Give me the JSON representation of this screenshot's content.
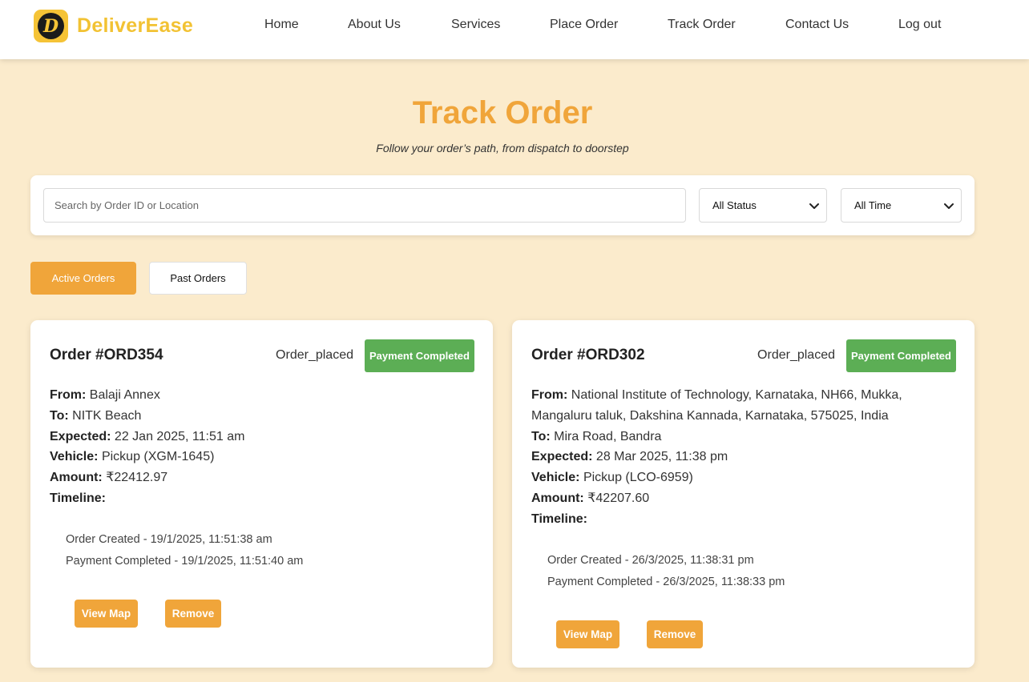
{
  "brand": {
    "name": "DeliverEase",
    "logo_letter": "D",
    "color": "#f2c233"
  },
  "nav": [
    {
      "label": "Home"
    },
    {
      "label": "About Us"
    },
    {
      "label": "Services"
    },
    {
      "label": "Place Order"
    },
    {
      "label": "Track Order"
    },
    {
      "label": "Contact Us"
    },
    {
      "label": "Log out"
    }
  ],
  "page": {
    "title": "Track Order",
    "subtitle": "Follow your order’s path, from dispatch to doorstep"
  },
  "filters": {
    "search_placeholder": "Search by Order ID or Location",
    "search_value": "",
    "status_selected": "All Status",
    "time_selected": "All Time"
  },
  "tabs": {
    "active": "Active Orders",
    "past": "Past Orders"
  },
  "labels": {
    "from": "From:",
    "to": "To:",
    "expected": "Expected:",
    "vehicle": "Vehicle:",
    "amount": "Amount:",
    "timeline": "Timeline:",
    "view_map": "View Map",
    "remove": "Remove"
  },
  "orders": [
    {
      "id": "Order #ORD354",
      "status": "Order_placed",
      "payment_badge": "Payment Completed",
      "from": "Balaji Annex",
      "to": "NITK Beach",
      "expected": "22 Jan 2025, 11:51 am",
      "vehicle": "Pickup (XGM-1645)",
      "amount": "₹22412.97",
      "timeline": [
        "Order Created - 19/1/2025, 11:51:38 am",
        "Payment Completed - 19/1/2025, 11:51:40 am"
      ]
    },
    {
      "id": "Order #ORD302",
      "status": "Order_placed",
      "payment_badge": "Payment Completed",
      "from": "National Institute of Technology, Karnataka, NH66, Mukka, Mangaluru taluk, Dakshina Kannada, Karnataka, 575025, India",
      "to": "Mira Road, Bandra",
      "expected": "28 Mar 2025, 11:38 pm",
      "vehicle": "Pickup (LCO-6959)",
      "amount": "₹42207.60",
      "timeline": [
        "Order Created - 26/3/2025, 11:38:31 pm",
        "Payment Completed - 26/3/2025, 11:38:33 pm"
      ]
    }
  ],
  "colors": {
    "accent": "#f0a53a",
    "success": "#5cae55",
    "background": "#fbebcc"
  }
}
